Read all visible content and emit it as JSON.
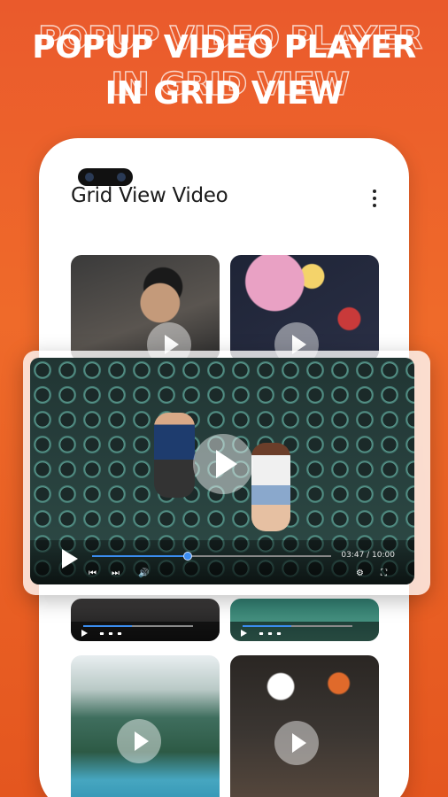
{
  "headline": {
    "line1": "POPUP VIDEO PLAYER",
    "line2": "IN GRID VIEW"
  },
  "app": {
    "title": "Grid View Video",
    "menu_icon": "kebab-menu-icon"
  },
  "thumbnails": [
    {
      "subject": "portrait",
      "icon": "play-circle-icon"
    },
    {
      "subject": "drink",
      "icon": "play-circle-icon"
    },
    {
      "subject": "dark-scene",
      "icon": "none"
    },
    {
      "subject": "green-scene",
      "icon": "none"
    },
    {
      "subject": "mountain-lake",
      "icon": "play-circle-icon"
    },
    {
      "subject": "basketball",
      "icon": "play-circle-icon"
    }
  ],
  "player": {
    "time": "03:47 / 10:00",
    "progress": 0.4,
    "controls": {
      "play": "play-icon",
      "prev": "skip-previous-icon",
      "next": "skip-next-icon",
      "volume": "volume-icon",
      "settings": "gear-icon",
      "fullscreen": "fullscreen-icon"
    }
  },
  "colors": {
    "background": "#ea5a2c",
    "accent": "#3b8df0",
    "text_dark": "#1b1b1b"
  }
}
